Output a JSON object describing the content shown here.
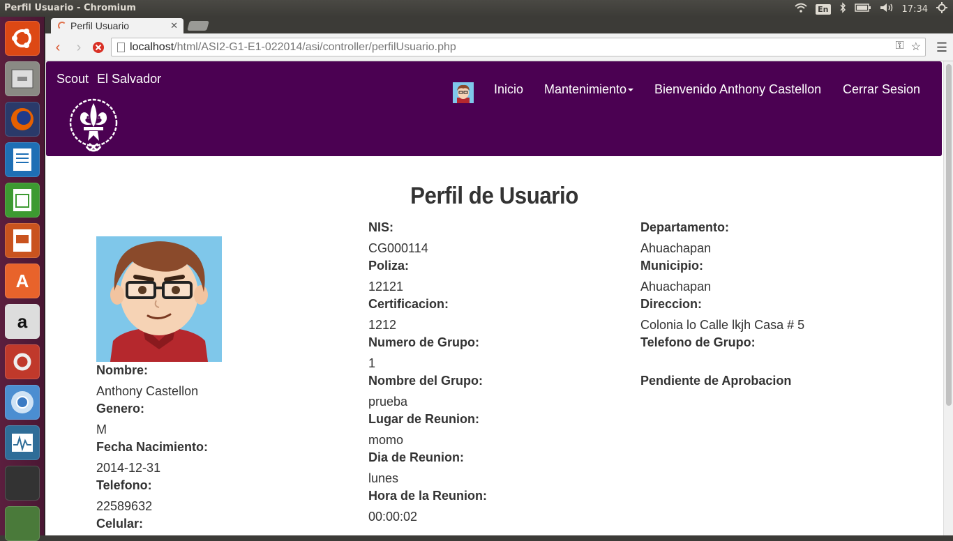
{
  "os": {
    "window_title": "Perfil Usuario - Chromium",
    "keyboard_layout": "En",
    "clock": "17:34"
  },
  "browser": {
    "tab_title": "Perfil Usuario",
    "url_host": "localhost",
    "url_path": "/html/ASI2-G1-E1-022014/asi/controller/perfilUsuario.php"
  },
  "site": {
    "brand_left": "Scout",
    "brand_right": "El Salvador",
    "nav": {
      "home": "Inicio",
      "maintenance": "Mantenimiento",
      "welcome": "Bienvenido Anthony Castellon",
      "logout": "Cerrar Sesion"
    }
  },
  "profile": {
    "title": "Perfil de Usuario",
    "col1": [
      {
        "label": "Nombre:",
        "value": "Anthony Castellon"
      },
      {
        "label": "Genero:",
        "value": "M"
      },
      {
        "label": "Fecha Nacimiento:",
        "value": "2014-12-31"
      },
      {
        "label": "Telefono:",
        "value": "22589632"
      },
      {
        "label": "Celular:",
        "value": ""
      }
    ],
    "col2": [
      {
        "label": "NIS:",
        "value": "CG000114"
      },
      {
        "label": "Poliza:",
        "value": "12121"
      },
      {
        "label": "Certificacion:",
        "value": "1212"
      },
      {
        "label": "Numero de Grupo:",
        "value": "1"
      },
      {
        "label": "Nombre del Grupo:",
        "value": "prueba"
      },
      {
        "label": "Lugar de Reunion:",
        "value": "momo"
      },
      {
        "label": "Dia de Reunion:",
        "value": "lunes"
      },
      {
        "label": "Hora de la Reunion:",
        "value": "00:00:02"
      }
    ],
    "col3": [
      {
        "label": "Departamento:",
        "value": "Ahuachapan"
      },
      {
        "label": "Municipio:",
        "value": "Ahuachapan"
      },
      {
        "label": "Direccion:",
        "value": "Colonia lo Calle lkjh Casa # 5"
      },
      {
        "label": "Telefono de Grupo:",
        "value": ""
      },
      {
        "label": "Pendiente de Aprobacion",
        "value": ""
      }
    ]
  }
}
